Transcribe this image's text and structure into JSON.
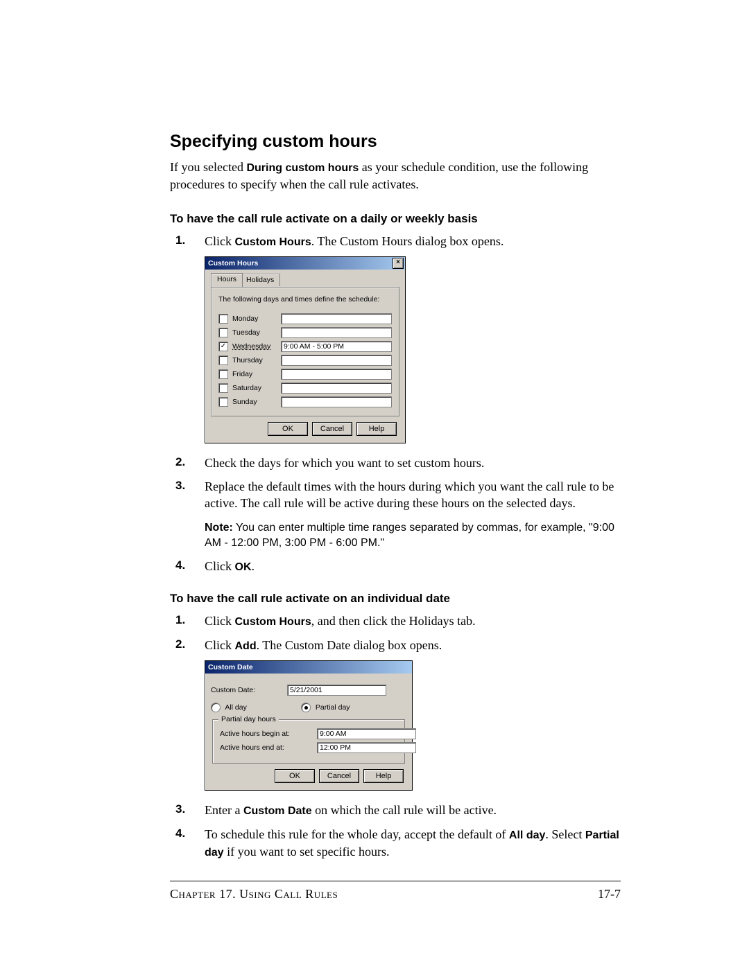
{
  "section": {
    "title": "Specifying custom hours"
  },
  "intro": {
    "prefix": "If you selected ",
    "bold": "During custom hours",
    "suffix": " as your schedule condition, use the following procedures to specify when the call rule activates."
  },
  "sub1": {
    "title": "To have the call rule activate on a daily or weekly basis"
  },
  "steps1": {
    "n1": "1.",
    "t1a": "Click ",
    "t1b": "Custom Hours",
    "t1c": ". The Custom Hours dialog box opens.",
    "n2": "2.",
    "t2": "Check the days for which you want to set custom hours.",
    "n3": "3.",
    "t3": "Replace the default times with the hours during which you want the call rule to be active. The call rule will be active during these hours on the selected days.",
    "note_label": "Note:",
    "note_text": "  You can enter multiple time ranges separated by commas, for example, \"9:00 AM - 12:00 PM, 3:00 PM - 6:00 PM.\"",
    "n4": "4.",
    "t4a": "Click ",
    "t4b": "OK",
    "t4c": "."
  },
  "sub2": {
    "title": "To have the call rule activate on an individual date"
  },
  "steps2": {
    "n1": "1.",
    "t1a": "Click ",
    "t1b": "Custom Hours",
    "t1c": ", and then click the Holidays tab.",
    "n2": "2.",
    "t2a": "Click ",
    "t2b": "Add",
    "t2c": ". The Custom Date dialog box opens.",
    "n3": "3.",
    "t3a": "Enter a ",
    "t3b": "Custom Date",
    "t3c": " on which the call rule will be active.",
    "n4": "4.",
    "t4a": "To schedule this rule for the whole day, accept the default of ",
    "t4b": "All day",
    "t4c": ". Select ",
    "t4d": "Partial day",
    "t4e": " if you want to set specific hours."
  },
  "dialog1": {
    "title": "Custom Hours",
    "close": "×",
    "tabs": {
      "hours": "Hours",
      "holidays": "Holidays"
    },
    "caption": "The following days and times define the schedule:",
    "days": {
      "mon": {
        "label": "Monday",
        "checked": false,
        "time": ""
      },
      "tue": {
        "label": "Tuesday",
        "checked": false,
        "time": ""
      },
      "wed": {
        "label": "Wednesday",
        "checked": true,
        "time": "9:00 AM - 5:00 PM"
      },
      "thu": {
        "label": "Thursday",
        "checked": false,
        "time": ""
      },
      "fri": {
        "label": "Friday",
        "checked": false,
        "time": ""
      },
      "sat": {
        "label": "Saturday",
        "checked": false,
        "time": ""
      },
      "sun": {
        "label": "Sunday",
        "checked": false,
        "time": ""
      }
    },
    "buttons": {
      "ok": "OK",
      "cancel": "Cancel",
      "help": "Help"
    }
  },
  "dialog2": {
    "title": "Custom Date",
    "labels": {
      "custom_date": "Custom Date:",
      "all_day": "All day",
      "partial_day": "Partial day",
      "legend": "Partial day hours",
      "begin": "Active hours begin at:",
      "end": "Active hours end at:"
    },
    "values": {
      "custom_date": "5/21/2001",
      "begin": "9:00 AM",
      "end": "12:00 PM"
    },
    "radio": {
      "all_day": false,
      "partial_day": true
    },
    "buttons": {
      "ok": "OK",
      "cancel": "Cancel",
      "help": "Help"
    }
  },
  "footer": {
    "chapter": "Chapter 17. Using Call Rules",
    "page": "17-7"
  }
}
